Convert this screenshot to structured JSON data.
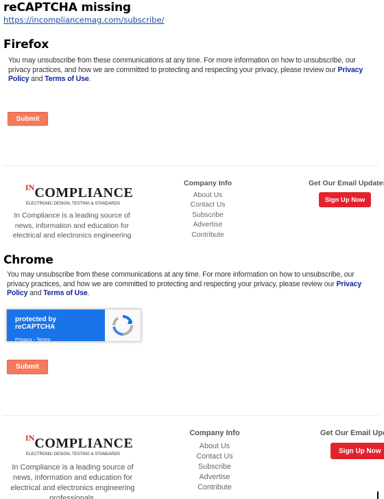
{
  "issue": {
    "title": "reCAPTCHA missing",
    "link": "https://incompliancemag.com/subscribe/"
  },
  "sections": [
    {
      "browser": "Firefox",
      "notice": {
        "text": "You may unsubscribe from these communications at any time. For more information on how to unsubscribe, our privacy practices, and how we are committed to protecting and respecting your privacy, please review our",
        "privacy_link": "Privacy Policy",
        "and": "and",
        "terms_link": "Terms of Use",
        "end": "."
      },
      "submit_label": "Submit",
      "footer": {
        "logo": {
          "in": "IN",
          "main": "COMPLIANCE",
          "tagline": "ELECTRONIC DESIGN, TESTING & STANDARDS"
        },
        "description": "In Compliance is a leading source of news, information and education for electrical and electronics engineering",
        "company_info": {
          "heading": "Company Info",
          "links": [
            "About Us",
            "Contact Us",
            "Subscribe",
            "Advertise",
            "Contribute"
          ]
        },
        "email": {
          "heading": "Get Our Email Updates",
          "button": "Sign Up Now"
        }
      }
    },
    {
      "browser": "Chrome",
      "notice": {
        "text": "You may unsubscribe from these communications at any time. For more information on how to unsubscribe, our privacy practices, and how we are committed to protecting and respecting your privacy, please review our",
        "privacy_link": "Privacy Policy",
        "and": "and",
        "terms_link": "Terms of Use",
        "end": "."
      },
      "recaptcha": {
        "protected_by": "protected by reCAPTCHA",
        "links": "Privacy - Terms",
        "colors": {
          "badge": "#1a73e8",
          "arrow_blue": "#1a73e8",
          "arrow_grey": "#b0b0b0"
        },
        "icon": "recaptcha-logo-icon"
      },
      "submit_label": "Submit",
      "footer": {
        "logo": {
          "in": "IN",
          "main": "COMPLIANCE",
          "tagline": "ELECTRONIC DESIGN, TESTING & STANDARDS"
        },
        "description": "In Compliance is a leading source of news, information and education for electrical and electronics engineering professionals.",
        "company_info": {
          "heading": "Company Info",
          "links": [
            "About Us",
            "Contact Us",
            "Subscribe",
            "Advertise",
            "Contribute"
          ]
        },
        "email": {
          "heading": "Get Our Email Updates",
          "button": "Sign Up Now"
        }
      }
    }
  ],
  "colors": {
    "submit": "#f47a5b",
    "signup": "#e2232e",
    "link": "#12259a",
    "logo_red": "#d8261e"
  }
}
